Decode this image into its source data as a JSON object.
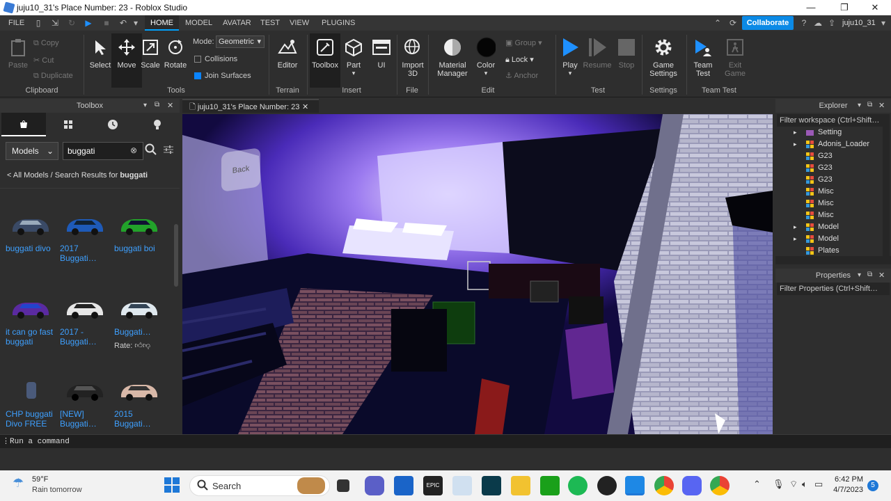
{
  "window": {
    "title": "juju10_31's Place Number: 23 - Roblox Studio",
    "min": "—",
    "max": "❐",
    "close": "✕"
  },
  "menu": {
    "file": "FILE",
    "tabs": [
      "HOME",
      "MODEL",
      "AVATAR",
      "TEST",
      "VIEW",
      "PLUGINS"
    ],
    "collaborate": "Collaborate",
    "username": "juju10_31"
  },
  "ribbon": {
    "clipboard": {
      "paste": "Paste",
      "copy": "Copy",
      "cut": "Cut",
      "duplicate": "Duplicate",
      "group": "Clipboard"
    },
    "tools": {
      "select": "Select",
      "move": "Move",
      "scale": "Scale",
      "rotate": "Rotate",
      "group": "Tools",
      "mode_label": "Mode:",
      "mode_value": "Geometric",
      "collisions": "Collisions",
      "join_surfaces": "Join Surfaces"
    },
    "terrain": {
      "editor": "Editor",
      "group": "Terrain"
    },
    "insert": {
      "toolbox": "Toolbox",
      "part": "Part",
      "ui": "UI",
      "group": "Insert"
    },
    "file": {
      "import": "Import 3D",
      "group": "File"
    },
    "edit": {
      "material": "Material Manager",
      "color": "Color",
      "group_btn": "Group",
      "lock": "Lock",
      "anchor": "Anchor",
      "group": "Edit"
    },
    "test": {
      "play": "Play",
      "resume": "Resume",
      "stop": "Stop",
      "group": "Test"
    },
    "settings": {
      "game_settings": "Game Settings",
      "group": "Settings"
    },
    "team_test": {
      "team_test": "Team Test",
      "exit_game": "Exit Game",
      "group": "Team Test"
    }
  },
  "toolbox": {
    "title": "Toolbox",
    "category": "Models",
    "search_value": "buggati",
    "breadcrumb_prefix": "< All Models / Search Results for ",
    "breadcrumb_query": "buggati",
    "rate_label": "Rate:",
    "items": [
      {
        "label": "buggati divo",
        "color": "#3a4a66"
      },
      {
        "label": "2017 Buggati…",
        "color": "#1e5ab8"
      },
      {
        "label": "buggati boi",
        "color": "#22a22a"
      },
      {
        "label": "it can go fast buggati",
        "color": "#5a2aa0"
      },
      {
        "label": "2017 - Buggati…",
        "color": "#e6e6e6"
      },
      {
        "label": "Buggati…",
        "color": "#dfe8ee"
      },
      {
        "label": "CHP buggati Divo FREE",
        "color": "#4a5a7a"
      },
      {
        "label": "[NEW] Buggati…",
        "color": "#222222"
      },
      {
        "label": "2015 Buggati…",
        "color": "#d8b8a8"
      }
    ]
  },
  "document_tab": "juju10_31's Place Number: 23",
  "explorer": {
    "title": "Explorer",
    "filter": "Filter workspace (Ctrl+Shift…",
    "rows": [
      {
        "label": "Setting",
        "expand": "▸"
      },
      {
        "label": "Adonis_Loader",
        "expand": "▸"
      },
      {
        "label": "G23",
        "expand": ""
      },
      {
        "label": "G23",
        "expand": ""
      },
      {
        "label": "G23",
        "expand": ""
      },
      {
        "label": "Misc",
        "expand": ""
      },
      {
        "label": "Misc",
        "expand": ""
      },
      {
        "label": "Misc",
        "expand": ""
      },
      {
        "label": "Model",
        "expand": "▸"
      },
      {
        "label": "Model",
        "expand": "▸"
      },
      {
        "label": "Plates",
        "expand": ""
      }
    ]
  },
  "properties": {
    "title": "Properties",
    "filter": "Filter Properties (Ctrl+Shift…"
  },
  "command_bar": "Run a command",
  "viewport": {
    "view_cube": "Back"
  },
  "taskbar": {
    "weather_temp": "59°F",
    "weather_desc": "Rain tomorrow",
    "search": "Search",
    "time": "6:42 PM",
    "date": "4/7/2023",
    "notifications": "5"
  }
}
